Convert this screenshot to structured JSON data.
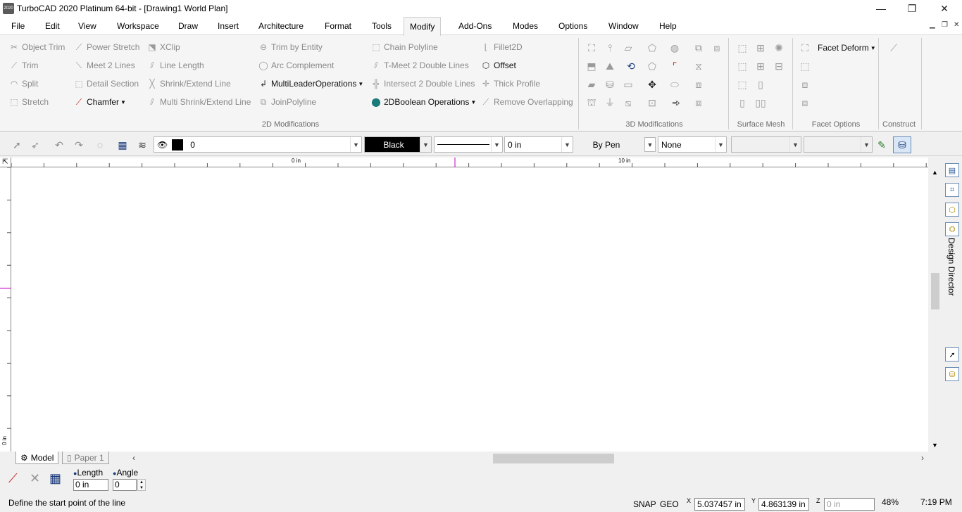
{
  "window": {
    "title": "TurboCAD 2020 Platinum 64-bit - [Drawing1 World Plan]",
    "app_icon_text": "2020",
    "controls": [
      "—",
      "❐",
      "✕"
    ]
  },
  "menu": {
    "items": [
      "File",
      "Edit",
      "View",
      "Workspace",
      "Draw",
      "Insert",
      "Architecture",
      "Format",
      "Tools",
      "Modify",
      "Add-Ons",
      "Modes",
      "Options",
      "Window",
      "Help"
    ],
    "active": "Modify"
  },
  "ribbon": {
    "groups": {
      "mod2d": "2D Modifications",
      "mod3d": "3D Modifications",
      "surface_mesh": "Surface Mesh",
      "facet_options": "Facet Options",
      "construct": "Construct"
    },
    "col1": [
      "Object Trim",
      "Trim",
      "Split",
      "Stretch"
    ],
    "col2": [
      "Power Stretch",
      "Meet 2 Lines",
      "Detail Section",
      "Chamfer"
    ],
    "col3": [
      "XClip",
      "Line Length",
      "Shrink/Extend Line",
      "Multi Shrink/Extend Line"
    ],
    "col4": [
      "Trim by Entity",
      "Arc Complement",
      "MultiLeaderOperations",
      "JoinPolyline"
    ],
    "col5": [
      "Chain Polyline",
      "T-Meet 2 Double Lines",
      "Intersect 2 Double Lines",
      "2DBoolean Operations"
    ],
    "col6": [
      "Fillet2D",
      "Offset",
      "Thick Profile",
      "Remove Overlapping"
    ],
    "facet_deform": "Facet Deform"
  },
  "property_bar": {
    "layer_value": "0",
    "color_value": "Black",
    "thickness_value": "0 in",
    "pen_value": "By Pen",
    "fill_value": "None"
  },
  "rulers": {
    "h_label_0": "0 in",
    "h_label_10": "10 in",
    "v_label_0": "0 in"
  },
  "tabs": [
    "Model",
    "Paper 1"
  ],
  "inspector": {
    "length_label": "Length",
    "angle_label": "Angle",
    "length_value": "0 in",
    "angle_value": "0"
  },
  "right_panel": {
    "design_director_label": "Design Director"
  },
  "status": {
    "prompt": "Define the start point of the line",
    "snap": "SNAP",
    "geo": "GEO",
    "x_label": "X",
    "y_label": "Y",
    "z_label": "Z",
    "x_value": "5.037457 in",
    "y_value": "4.863139 in",
    "z_value": "0 in",
    "zoom": "48%",
    "time": "7:19 PM"
  },
  "colors": {
    "active_tab_bg": "#f5f5f5",
    "color_swatch": "#000000",
    "cursor_marker": "#c000c0"
  }
}
